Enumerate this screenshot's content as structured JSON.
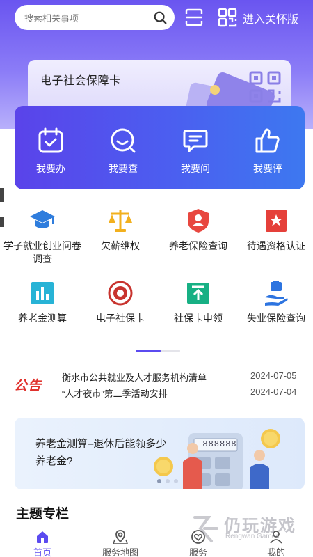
{
  "search": {
    "placeholder": "搜索相关事项",
    "icon": "search-icon"
  },
  "header": {
    "care_mode_label": "进入关怀版"
  },
  "social_card": {
    "title": "电子社会保障卡"
  },
  "quick_panel": [
    {
      "label": "我要办",
      "icon": "calendar-check-icon"
    },
    {
      "label": "我要查",
      "icon": "search-smile-icon"
    },
    {
      "label": "我要问",
      "icon": "chat-bubble-icon"
    },
    {
      "label": "我要评",
      "icon": "thumbs-up-icon"
    }
  ],
  "services": [
    {
      "label": "学子就业创业问卷调查",
      "icon": "graduation-cap-icon",
      "color": "#2f7ddd"
    },
    {
      "label": "欠薪维权",
      "icon": "scales-icon",
      "color": "#f2b01e"
    },
    {
      "label": "养老保险查询",
      "icon": "shield-user-icon",
      "color": "#e8473f"
    },
    {
      "label": "待遇资格认证",
      "icon": "star-badge-icon",
      "color": "#e5403a"
    },
    {
      "label": "养老金测算",
      "icon": "bar-chart-icon",
      "color": "#27b3d6"
    },
    {
      "label": "电子社保卡",
      "icon": "seal-icon",
      "color": "#c8332e"
    },
    {
      "label": "社保卡申领",
      "icon": "upload-card-icon",
      "color": "#17b084"
    },
    {
      "label": "失业保险查询",
      "icon": "hand-briefcase-icon",
      "color": "#2d74e0"
    }
  ],
  "notice": {
    "logo": "公告",
    "items": [
      {
        "title": "衡水市公共就业及人才服务机构清单",
        "date": "2024-07-05"
      },
      {
        "title": "“人才夜市”第二季活动安排",
        "date": "2024-07-04"
      }
    ]
  },
  "banner": {
    "title": "养老金测算–退休后能领多少养老金?",
    "calc_display": "888888"
  },
  "section": {
    "title": "主题专栏"
  },
  "tabs": [
    {
      "label": "首页",
      "icon": "home-icon",
      "active": true
    },
    {
      "label": "服务地图",
      "icon": "map-pin-icon",
      "active": false
    },
    {
      "label": "服务",
      "icon": "heart-icon",
      "active": false
    },
    {
      "label": "我的",
      "icon": "user-icon",
      "active": false
    }
  ],
  "watermark": {
    "name": "仍玩游戏",
    "sub": "Rengwan Games"
  },
  "colors": {
    "primary": "#5b4bf0",
    "hero_top": "#6a55f0"
  }
}
